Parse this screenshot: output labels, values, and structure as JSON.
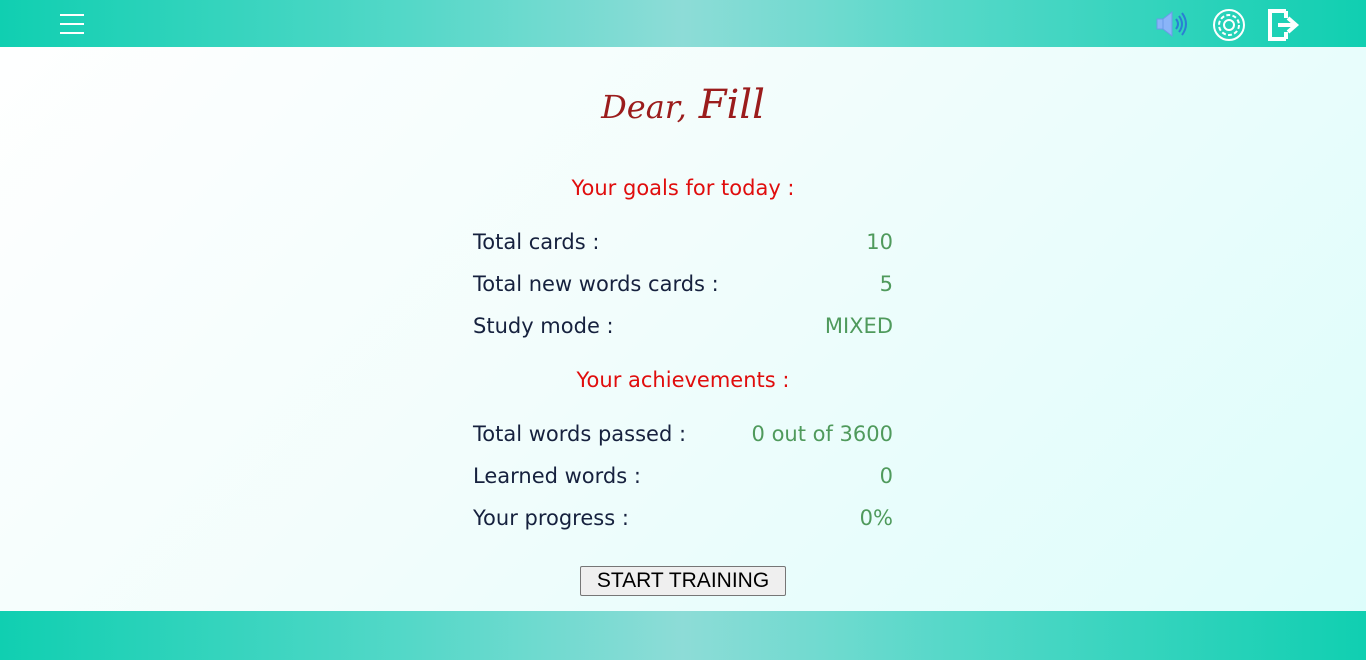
{
  "header": {
    "icons": [
      "menu-icon",
      "sound-icon",
      "settings-icon",
      "logout-icon"
    ]
  },
  "greeting": {
    "prefix": "Dear,",
    "name": "Fill"
  },
  "goals": {
    "title": "Your goals for today :",
    "rows": [
      {
        "label": "Total cards :",
        "value": "10"
      },
      {
        "label": "Total new words cards :",
        "value": "5"
      },
      {
        "label": "Study mode :",
        "value": "MIXED"
      }
    ]
  },
  "achievements": {
    "title": "Your achievements :",
    "rows": [
      {
        "label": "Total words passed :",
        "value": "0 out of 3600"
      },
      {
        "label": "Learned words :",
        "value": "0"
      },
      {
        "label": "Your progress :",
        "value": "0%"
      }
    ]
  },
  "actions": {
    "start_label": "START TRAINING"
  },
  "colors": {
    "header_accent": "#10cfb1",
    "greeting": "#9b1c1c",
    "section_title": "#e00d0d",
    "label": "#16213e",
    "value": "#4f9a5c"
  }
}
